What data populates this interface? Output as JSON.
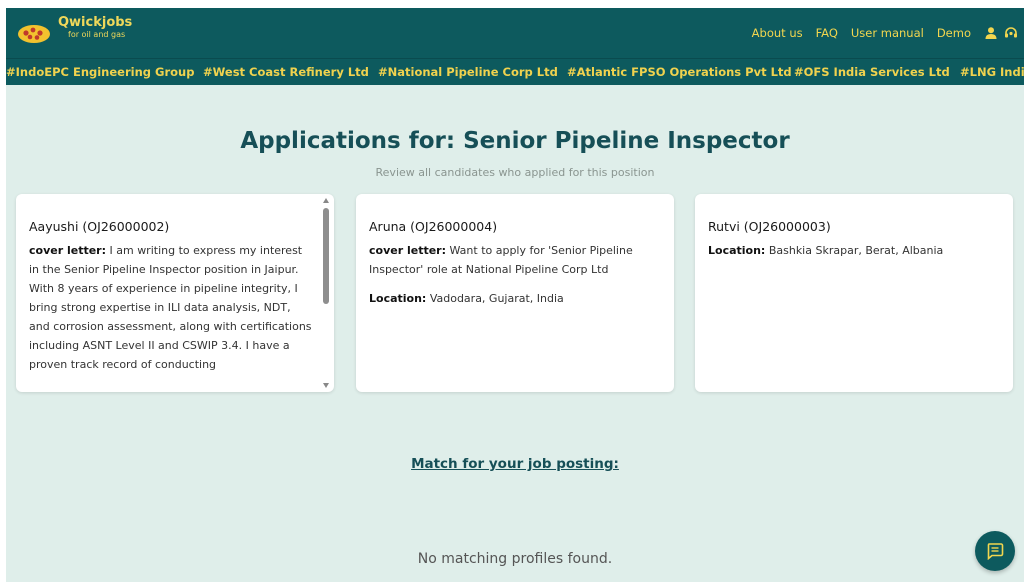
{
  "header": {
    "brand_name": "Qwickjobs",
    "brand_tagline": "for oil and gas",
    "nav": [
      "About us",
      "FAQ",
      "User manual",
      "Demo"
    ],
    "icons": [
      "user-icon",
      "support-icon"
    ]
  },
  "companies": [
    "#IndoEPC Engineering Group",
    "#West Coast Refinery Ltd",
    "#National Pipeline Corp Ltd",
    "#Atlantic FPSO Operations Pvt Ltd",
    "#OFS India Services Ltd",
    "#LNG India"
  ],
  "main": {
    "title": "Applications for: Senior Pipeline Inspector",
    "subtitle": "Review all candidates who applied for this position"
  },
  "applications": [
    {
      "name": "Aayushi (OJ26000002)",
      "cover_label": "cover letter:",
      "cover_text": " I am writing to express my interest in the Senior Pipeline Inspector position in Jaipur. With 8 years of experience in pipeline integrity, I bring strong expertise in ILI data analysis, NDT, and corrosion assessment, along with certifications including ASNT Level II and CSWIP 3.4. I have a proven track record of conducting"
    },
    {
      "name": "Aruna (OJ26000004)",
      "cover_label": "cover letter:",
      "cover_text": " Want to apply for 'Senior Pipeline Inspector' role at National Pipeline Corp Ltd",
      "location_label": "Location:",
      "location": " Vadodara, Gujarat, India"
    },
    {
      "name": "Rutvi (OJ26000003)",
      "location_label": "Location:",
      "location": " Bashkia Skrapar, Berat, Albania"
    }
  ],
  "match": {
    "link": "Match for your job posting:",
    "empty": "No matching profiles found."
  },
  "colors": {
    "brand": "#0d5a5e",
    "accent": "#f0d24e",
    "background": "#dfeeea"
  }
}
